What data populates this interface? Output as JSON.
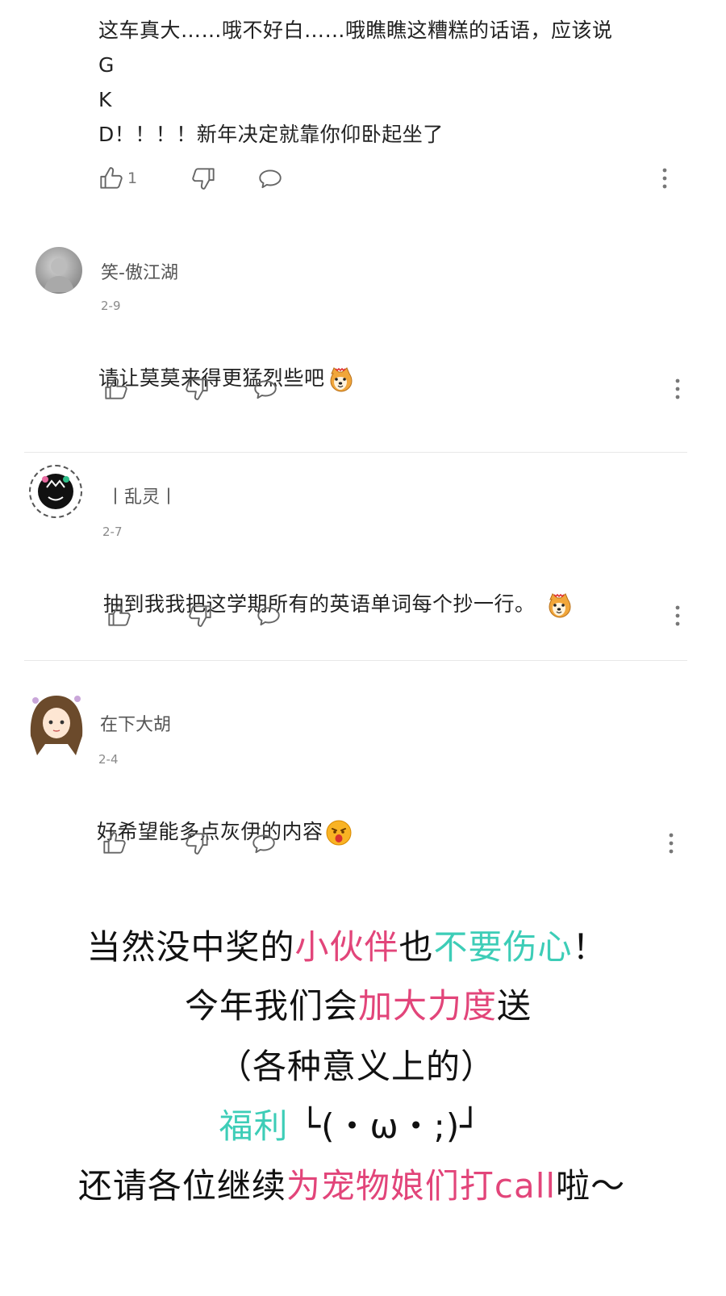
{
  "comments": [
    {
      "text": "这车真大……哦不好白……哦瞧瞧这糟糕的话语，应该说\nG\nK\nD！！！！新年决定就靠你仰卧起坐了",
      "like_count": "1"
    },
    {
      "user": "笑-傲江湖",
      "date": "2-9",
      "text": "请让莫莫来得更猛烈些吧",
      "emoji": "shiba-dog-emoji"
    },
    {
      "user": "丨乱灵丨",
      "date": "2-7",
      "text": "抽到我我把这学期所有的英语单词每个抄一行。",
      "emoji": "shiba-dog-emoji"
    },
    {
      "user": "在下大胡",
      "date": "2-4",
      "text": "好希望能多点灰伊的内容",
      "emoji": "surprised-face-emoji"
    }
  ],
  "banner": {
    "line1": {
      "a": "当然没中奖的",
      "b": "小伙伴",
      "c": "也",
      "d": "不要伤心",
      "e": "！"
    },
    "line2": {
      "a": "今年我们会",
      "b": "加大力度",
      "c": "送"
    },
    "line3": "（各种意义上的）",
    "line4": {
      "a": "福利",
      "b": " └(・ω・;)┘"
    },
    "line5": {
      "a": "还请各位继续",
      "b": "为宠物娘们打call",
      "c": "啦～"
    }
  },
  "colors": {
    "pink": "#e2457a",
    "teal": "#3dcdb7"
  }
}
